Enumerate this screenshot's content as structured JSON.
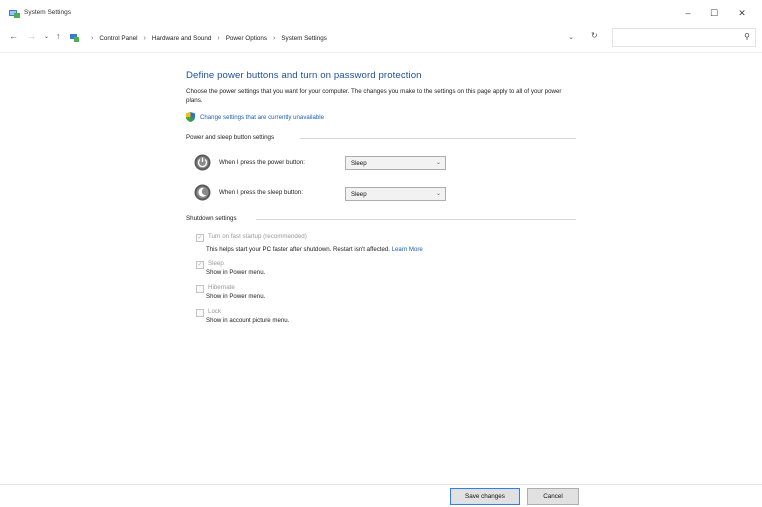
{
  "window": {
    "title": "System Settings",
    "minimize": "–",
    "maximize": "☐",
    "close": "✕"
  },
  "nav": {
    "back": "←",
    "forward": "→",
    "recent": "⌄",
    "up": "↑",
    "breadcrumbs": [
      "Control Panel",
      "Hardware and Sound",
      "Power Options",
      "System Settings"
    ],
    "separator": "›",
    "dropdown": "⌄",
    "refresh": "↻",
    "search_placeholder": "",
    "search_icon": "⚲"
  },
  "main": {
    "heading": "Define power buttons and turn on password protection",
    "description": "Choose the power settings that you want for your computer. The changes you make to the settings on this page apply to all of your power plans.",
    "unavailable_link": "Change settings that are currently unavailable"
  },
  "power_buttons": {
    "group_title": "Power and sleep button settings",
    "rows": [
      {
        "label": "When I press the power button:",
        "value": "Sleep"
      },
      {
        "label": "When I press the sleep button:",
        "value": "Sleep"
      }
    ]
  },
  "shutdown": {
    "group_title": "Shutdown settings",
    "fast_startup": {
      "title": "Turn on fast startup (recommended)",
      "desc": "This helps start your PC faster after shutdown. Restart isn't affected.",
      "link": "Learn More"
    },
    "items": [
      {
        "title": "Sleep",
        "desc": "Show in Power menu.",
        "checked": true
      },
      {
        "title": "Hibernate",
        "desc": "Show in Power menu.",
        "checked": false
      },
      {
        "title": "Lock",
        "desc": "Show in account picture menu.",
        "checked": false
      }
    ],
    "check_mark": "✓"
  },
  "footer": {
    "save": "Save changes",
    "cancel": "Cancel"
  },
  "colors": {
    "heading": "#1e4e99",
    "link": "#1a5fb4",
    "primary_border": "#3c7fd1"
  }
}
